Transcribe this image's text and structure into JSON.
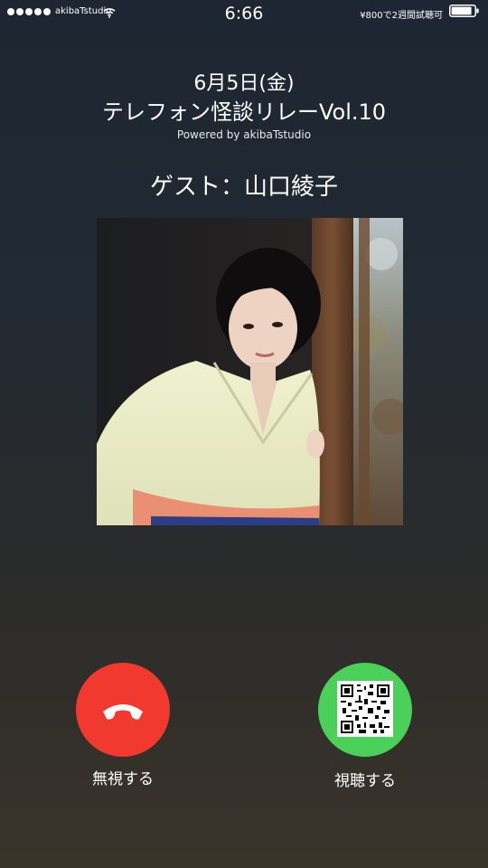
{
  "status_bar": {
    "carrier": "akibaTstudio",
    "time": "6:66",
    "promo": "¥800で2週間試聴可",
    "signal_icon": "signal-dots-icon",
    "wifi_icon": "wifi-icon",
    "battery_icon": "battery-icon"
  },
  "call": {
    "date": "6月5日(金)",
    "title": "テレフォン怪談リレーVol.10",
    "powered_by": "Powered by akibaTstudio",
    "guest": "ゲスト：山口綾子"
  },
  "actions": {
    "decline_label": "無視する",
    "decline_icon": "phone-hangup-icon",
    "decline_color": "#f2392f",
    "accept_label": "視聴する",
    "accept_icon": "qr-code-icon",
    "accept_color": "#4bd15a"
  }
}
